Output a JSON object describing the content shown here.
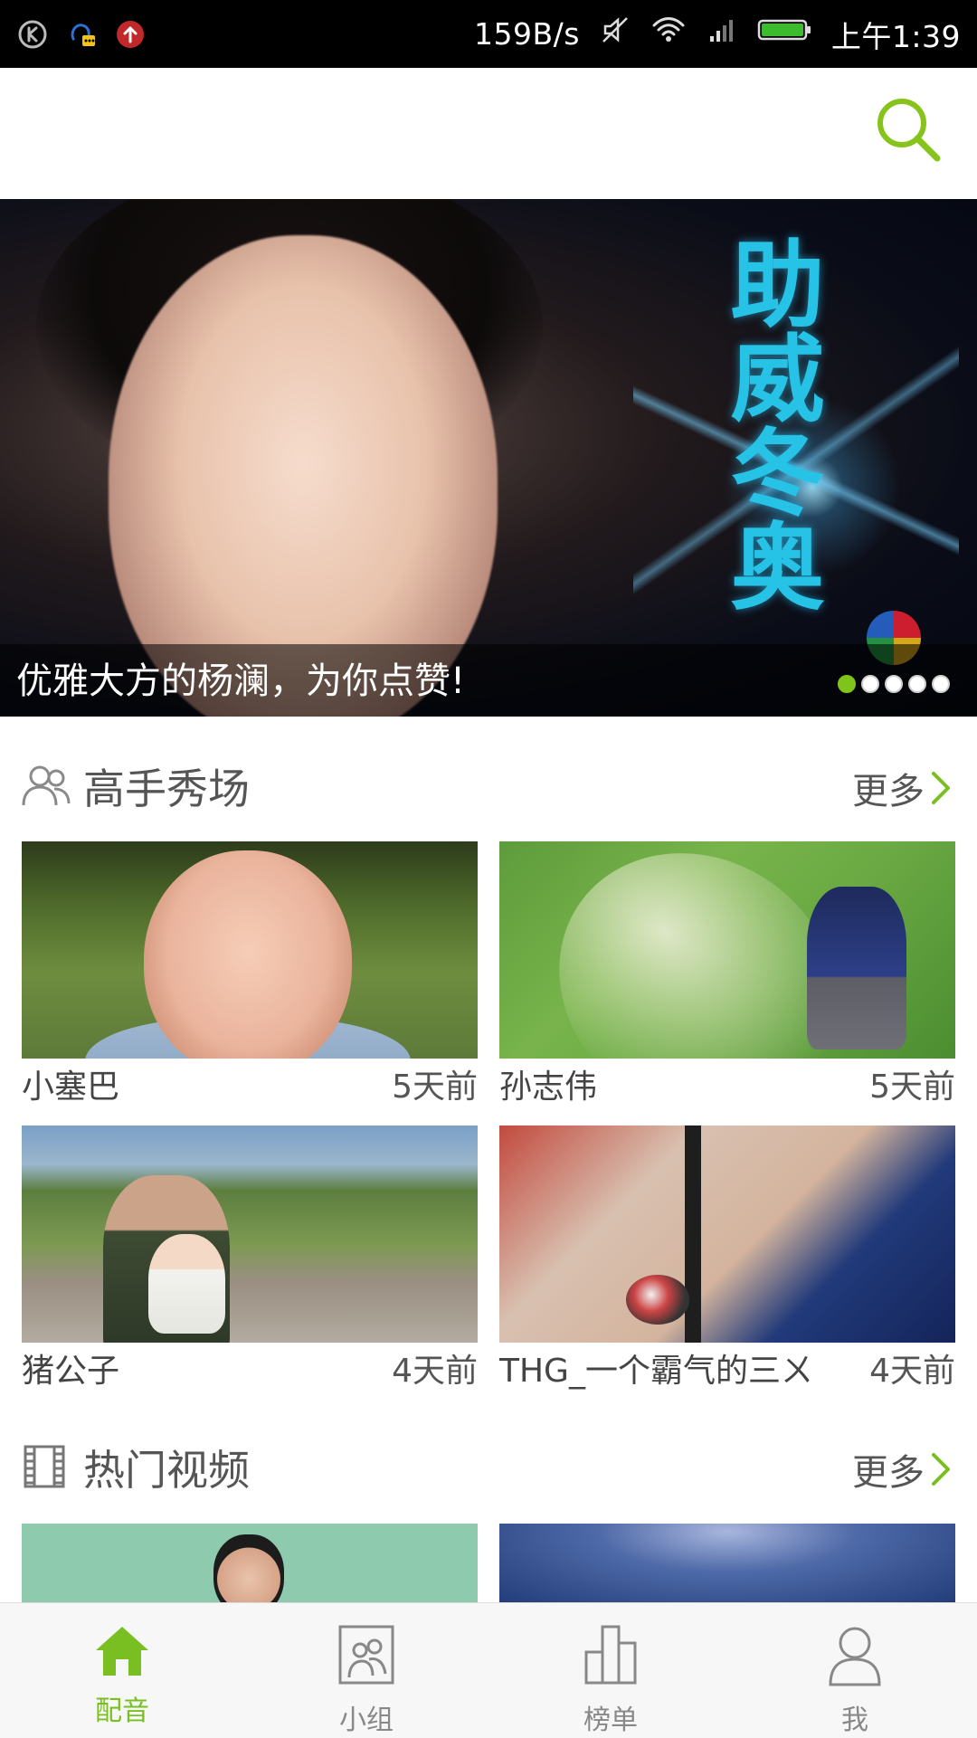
{
  "status_bar": {
    "speed": "159B/s",
    "time": "上午1:39"
  },
  "banner": {
    "vertical_text": "助威冬奥",
    "caption": "优雅大方的杨澜，为你点赞!",
    "dots": [
      true,
      false,
      false,
      false,
      false
    ]
  },
  "sections": {
    "experts": {
      "title": "高手秀场",
      "more": "更多",
      "items": [
        {
          "name": "小塞巴",
          "time": "5天前"
        },
        {
          "name": "孙志伟",
          "time": "5天前"
        },
        {
          "name": "猪公子",
          "time": "4天前"
        },
        {
          "name": "THG_一个霸气的三ㄨ",
          "time": "4天前"
        }
      ]
    },
    "hot_videos": {
      "title": "热门视频",
      "more": "更多"
    }
  },
  "bottom_nav": [
    {
      "label": "配音",
      "active": true
    },
    {
      "label": "小组",
      "active": false
    },
    {
      "label": "榜单",
      "active": false
    },
    {
      "label": "我",
      "active": false
    }
  ],
  "colors": {
    "accent": "#79bf21",
    "status_bar_bg": "#000000",
    "nav_bg": "#f7f7f7"
  }
}
